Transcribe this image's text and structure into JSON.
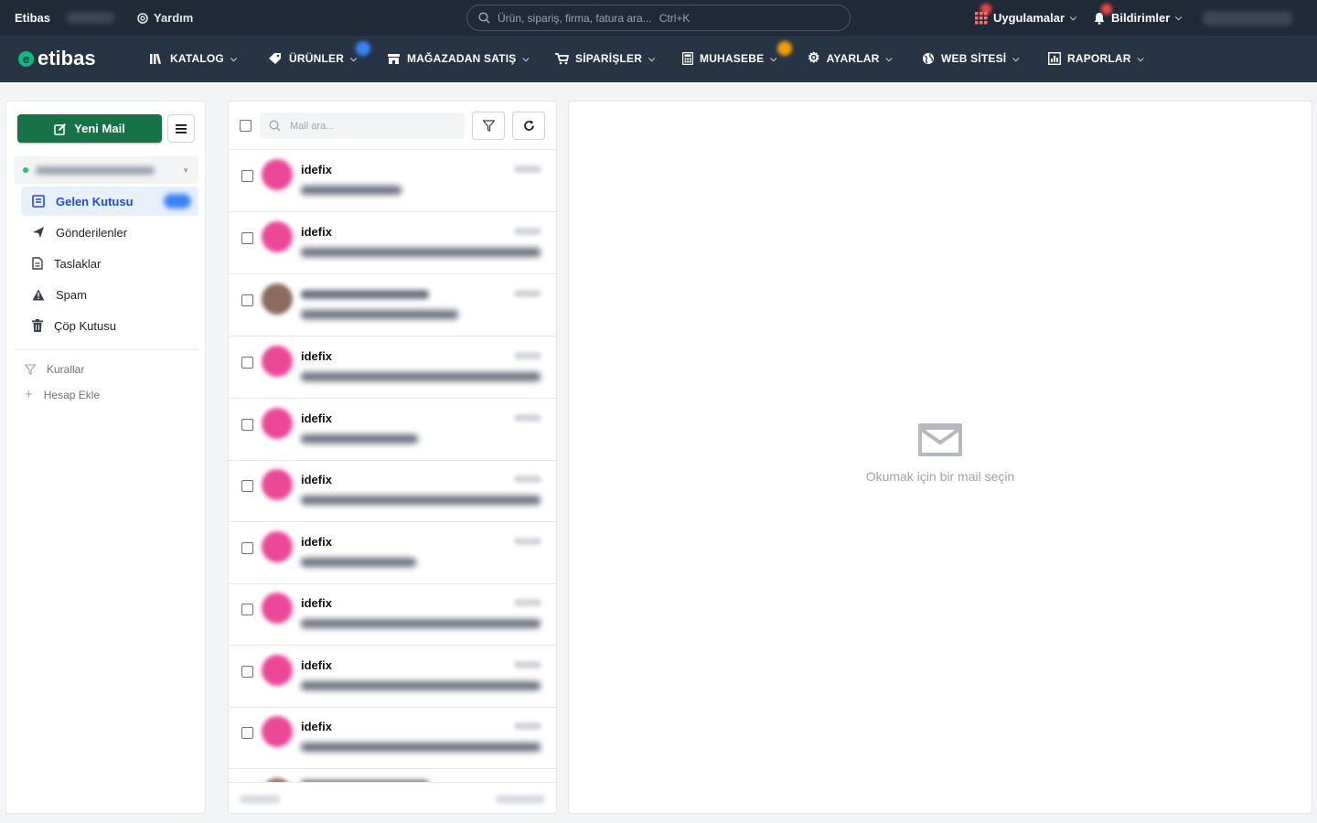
{
  "topbar": {
    "brand": "Etibas",
    "help_label": "Yardım",
    "search_placeholder": "Ürün, sipariş, firma, fatura ara...",
    "search_shortcut": "Ctrl+K",
    "apps_label": "Uygulamalar",
    "notifications_label": "Bildirimler"
  },
  "navbar": {
    "logo": "etibas",
    "items": [
      {
        "label": "KATALOG",
        "icon": "books-icon"
      },
      {
        "label": "ÜRÜNLER",
        "icon": "tag-icon"
      },
      {
        "label": "MAĞAZADAN SATIŞ",
        "icon": "store-icon"
      },
      {
        "label": "SİPARİŞLER",
        "icon": "cart-icon"
      },
      {
        "label": "MUHASEBE",
        "icon": "calculator-icon"
      },
      {
        "label": "AYARLAR",
        "icon": "gear-icon"
      },
      {
        "label": "WEB SİTESİ",
        "icon": "globe-icon"
      },
      {
        "label": "RAPORLAR",
        "icon": "report-icon"
      }
    ],
    "badge_colors": {
      "urunler": "#3b82f6",
      "muhasebe": "#f59e0b"
    }
  },
  "sidebar": {
    "new_mail_label": "Yeni Mail",
    "folders": [
      {
        "label": "Gelen Kutusu",
        "icon": "inbox-icon",
        "active": true
      },
      {
        "label": "Gönderilenler",
        "icon": "send-icon"
      },
      {
        "label": "Taslaklar",
        "icon": "draft-icon"
      },
      {
        "label": "Spam",
        "icon": "warning-icon"
      },
      {
        "label": "Çöp Kutusu",
        "icon": "trash-icon"
      }
    ],
    "utilities": [
      {
        "label": "Kurallar",
        "icon": "filter-icon"
      },
      {
        "label": "Hesap Ekle",
        "icon": "plus-icon"
      }
    ]
  },
  "maillist": {
    "search_placeholder": "Mail ara...",
    "rows": [
      {
        "sender": "idefix",
        "avatar": "pink"
      },
      {
        "sender": "idefix",
        "avatar": "pink"
      },
      {
        "sender": "",
        "avatar": "brown"
      },
      {
        "sender": "idefix",
        "avatar": "pink"
      },
      {
        "sender": "idefix",
        "avatar": "pink"
      },
      {
        "sender": "idefix",
        "avatar": "pink"
      },
      {
        "sender": "idefix",
        "avatar": "pink"
      },
      {
        "sender": "idefix",
        "avatar": "pink"
      },
      {
        "sender": "idefix",
        "avatar": "pink"
      },
      {
        "sender": "idefix",
        "avatar": "pink"
      }
    ]
  },
  "reader": {
    "empty_text": "Okumak için bir mail seçin",
    "empty_icon": "envelope-icon"
  },
  "colors": {
    "topbar": "#1f2937",
    "navbar": "#273445",
    "primary_green": "#157347",
    "active_folder_bg": "#e8f0fb",
    "avatar_pink": "#ec4899"
  }
}
